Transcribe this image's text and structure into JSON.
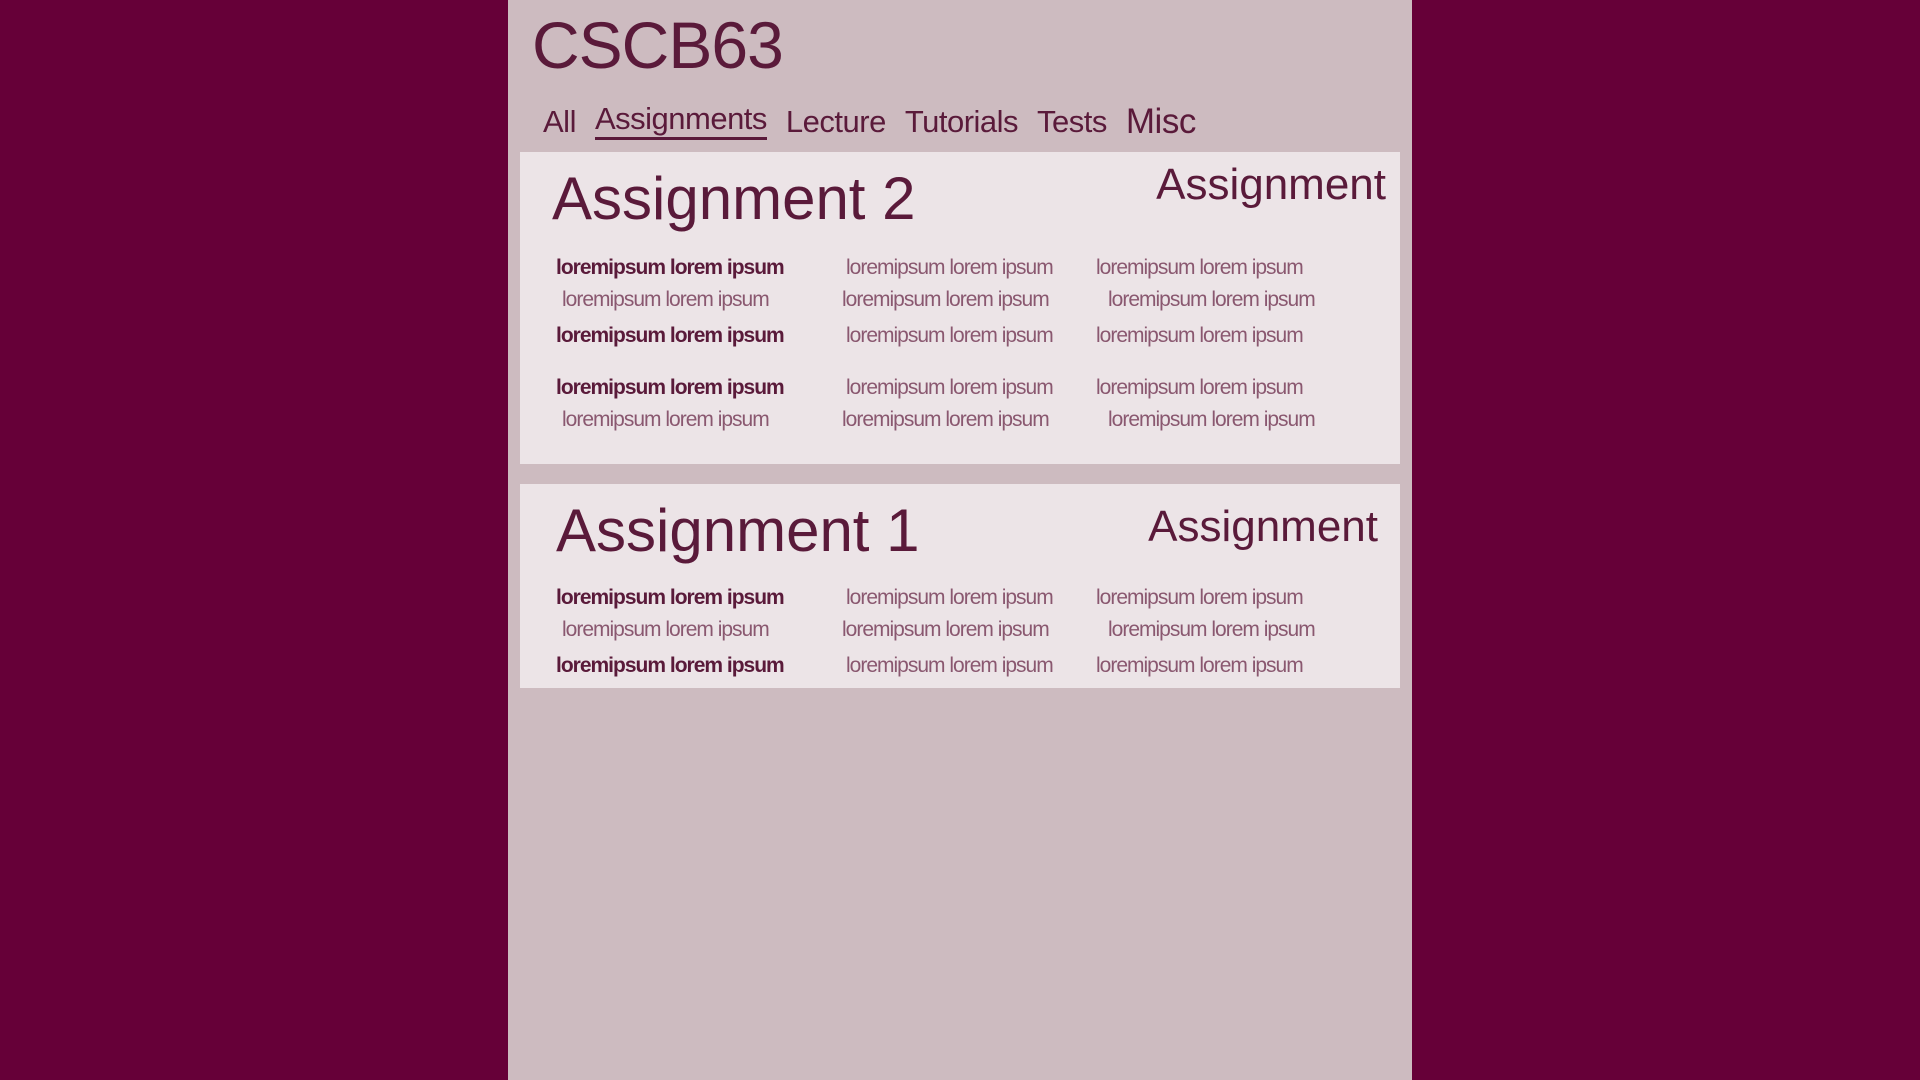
{
  "site": {
    "title": "CSCB63"
  },
  "nav": {
    "tabs": [
      {
        "label": "All"
      },
      {
        "label": "Assignments"
      },
      {
        "label": "Lecture"
      },
      {
        "label": "Tutorials"
      },
      {
        "label": "Tests"
      },
      {
        "label": "Misc"
      }
    ]
  },
  "posts": [
    {
      "title": "Assignment 2",
      "type": "Assignment",
      "lines": [
        [
          "loremipsum lorem ipsum",
          "loremipsum lorem ipsum",
          "loremipsum lorem ipsum"
        ],
        [
          "loremipsum lorem ipsum",
          "loremipsum lorem ipsum",
          "loremipsum lorem ipsum"
        ],
        [
          "loremipsum lorem ipsum",
          "loremipsum lorem ipsum",
          "loremipsum lorem ipsum"
        ],
        [
          "loremipsum lorem ipsum",
          "loremipsum lorem ipsum",
          "loremipsum lorem ipsum"
        ],
        [
          "loremipsum lorem ipsum",
          "loremipsum lorem ipsum",
          "loremipsum lorem ipsum"
        ]
      ]
    },
    {
      "title": "Assignment 1",
      "type": "Assignment",
      "lines": [
        [
          "loremipsum lorem ipsum",
          "loremipsum lorem ipsum",
          "loremipsum lorem ipsum"
        ],
        [
          "loremipsum lorem ipsum",
          "loremipsum lorem ipsum",
          "loremipsum lorem ipsum"
        ],
        [
          "loremipsum lorem ipsum",
          "loremipsum lorem ipsum",
          "loremipsum lorem ipsum"
        ]
      ]
    }
  ],
  "colors": {
    "outer_background": "#660038",
    "page_background": "#cdbbc0",
    "card_background": "#ece4e7",
    "text_primary": "#5a1a3a",
    "text_muted": "#8a5870"
  }
}
